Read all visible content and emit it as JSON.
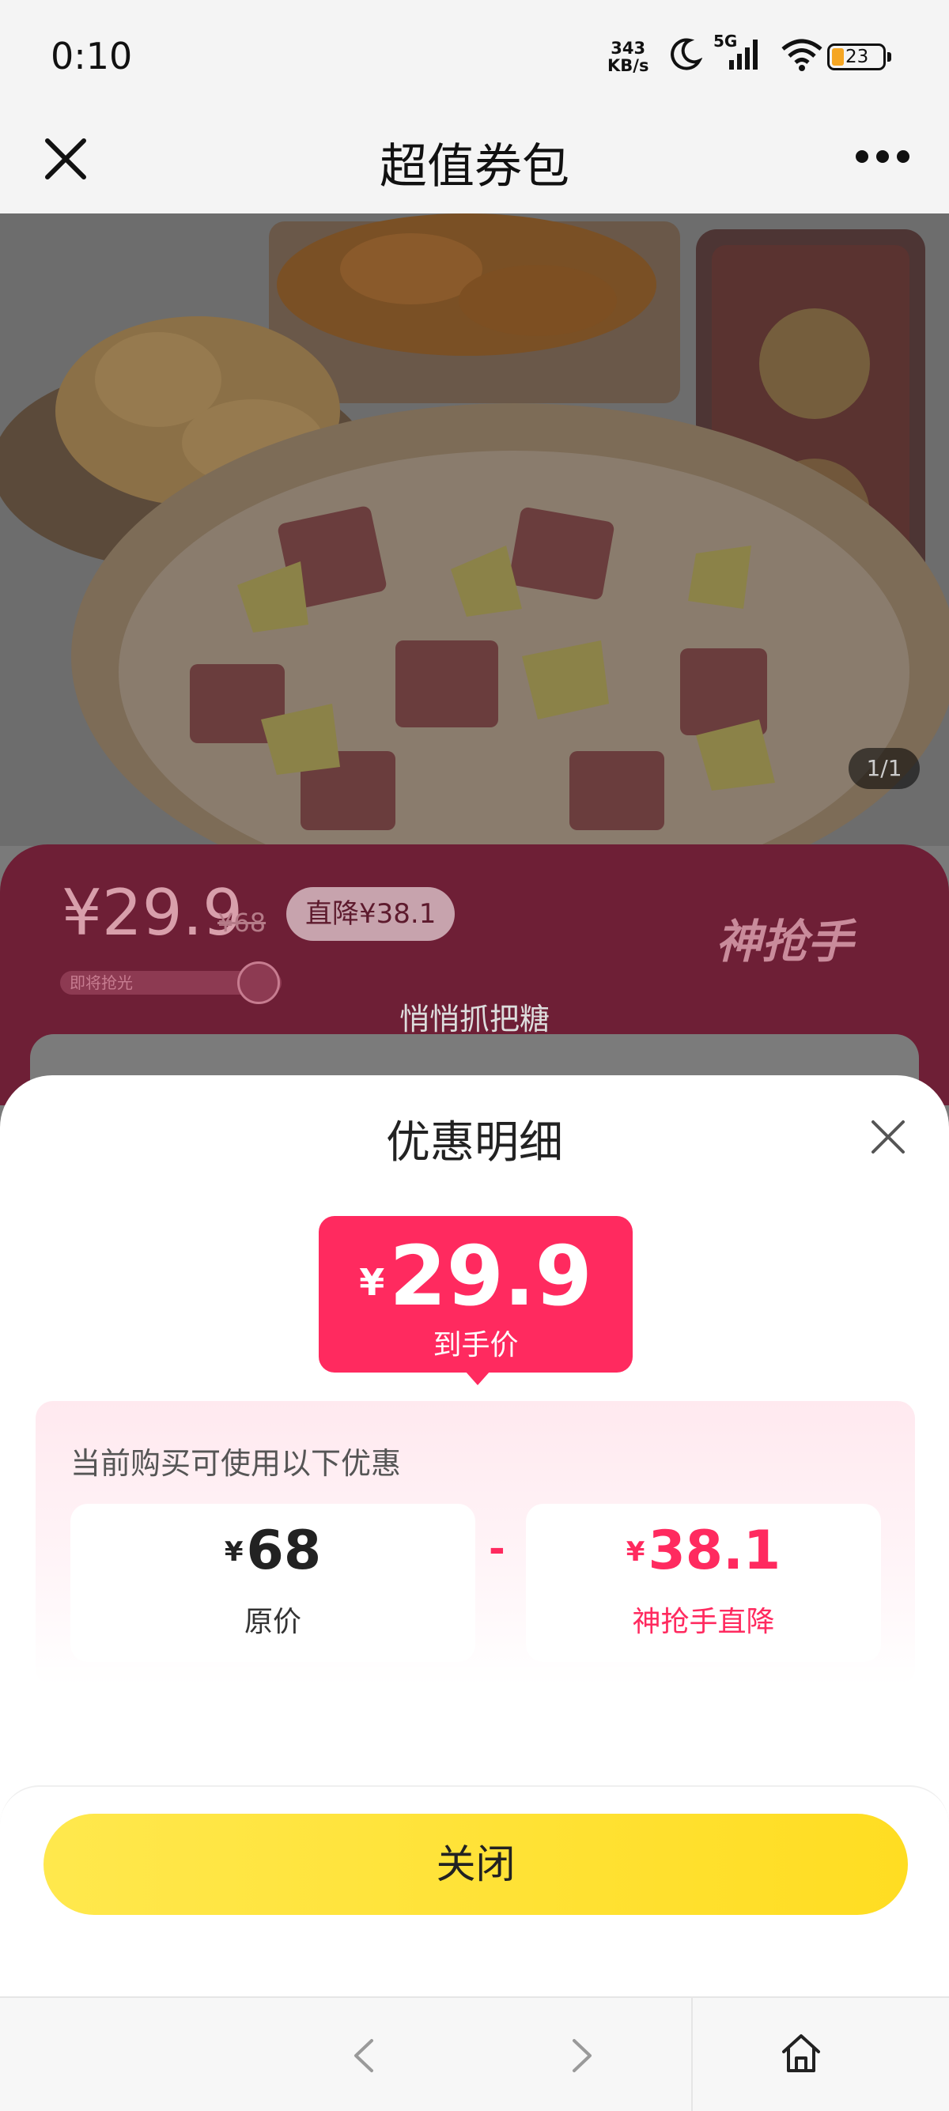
{
  "status_bar": {
    "time": "0:10",
    "net_speed_value": "343",
    "net_speed_unit": "KB/s",
    "network": "5G",
    "battery": "23"
  },
  "nav": {
    "title": "超值券包",
    "close_icon": "close-icon",
    "more_icon": "more-icon"
  },
  "hero": {
    "counter": "1/1"
  },
  "banner": {
    "price": "¥29.9",
    "original": "¥68",
    "tag": "直降¥38.1",
    "stock_text": "即将抢光",
    "brand": "神抢手",
    "slogan": "悄悄抓把糖"
  },
  "sheet": {
    "title": "优惠明细",
    "final_price": {
      "currency": "¥",
      "amount": "29.9",
      "label": "到手价"
    },
    "discount_heading": "当前购买可使用以下优惠",
    "original": {
      "currency": "¥",
      "amount": "68",
      "label": "原价"
    },
    "operator": "-",
    "discount": {
      "currency": "¥",
      "amount": "38.1",
      "label": "神抢手直降"
    },
    "close_button": "关闭"
  },
  "colors": {
    "accent": "#ff2a5f",
    "button_yellow": "#ffe33a"
  }
}
